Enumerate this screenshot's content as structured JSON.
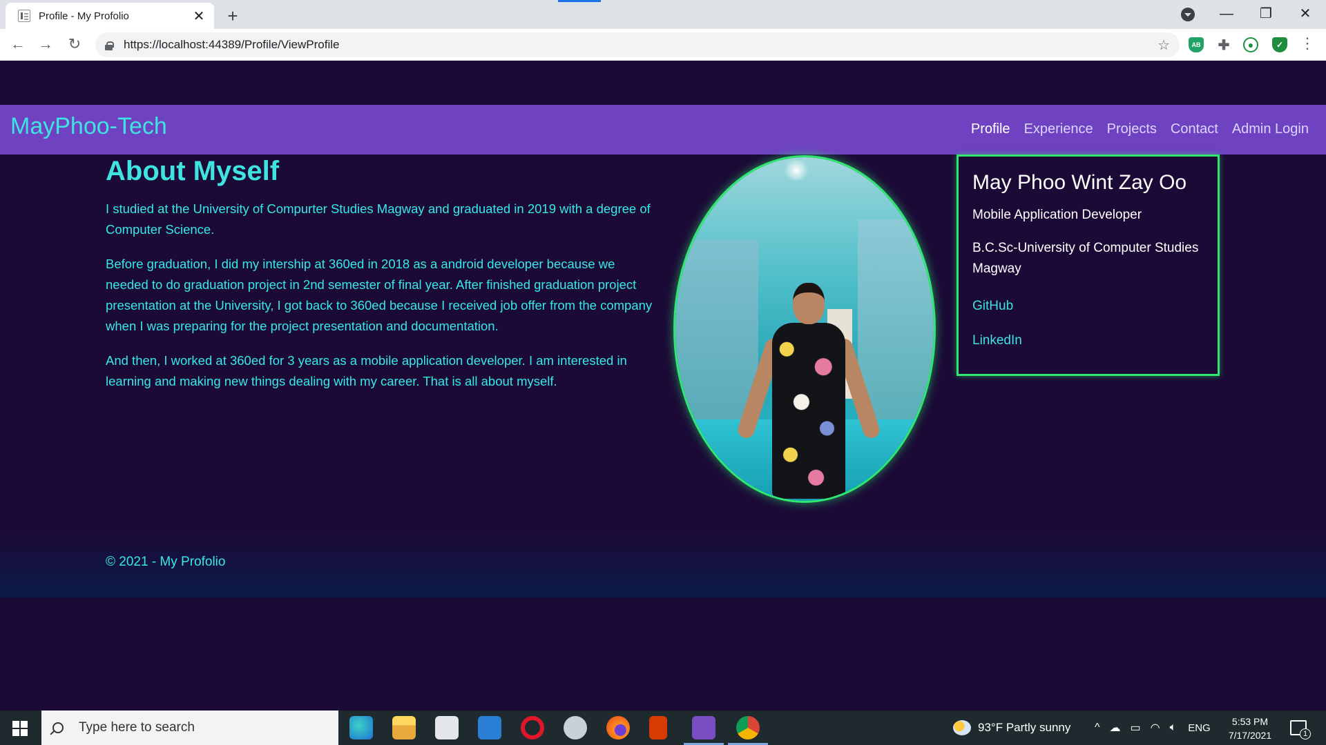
{
  "browser": {
    "tab_title": "Profile - My Profolio",
    "tab_close": "✕",
    "new_tab": "+",
    "url": "https://localhost:44389/Profile/ViewProfile",
    "minimize": "—",
    "maximize": "❐",
    "close": "✕",
    "back": "←",
    "forward": "→",
    "reload": "↻",
    "star": "☆",
    "menu": "⋮"
  },
  "extensions": {
    "adblock_label": "AB",
    "puzzle_icon": "puzzle-icon",
    "profile_icon": "profile-icon",
    "shield_label": "✓"
  },
  "site": {
    "brand": "MayPhoo-Tech",
    "nav": [
      {
        "label": "Profile",
        "active": true
      },
      {
        "label": "Experience",
        "active": false
      },
      {
        "label": "Projects",
        "active": false
      },
      {
        "label": "Contact",
        "active": false
      },
      {
        "label": "Admin Login",
        "active": false
      }
    ],
    "accent_color": "#3fe3e0",
    "navbar_color": "#6f42c1",
    "border_color": "#2ee86f"
  },
  "about": {
    "title": "About Myself",
    "paragraphs": [
      "I studied at the University of Compurter Studies Magway and graduated in 2019 with a degree of Computer Science.",
      "Before graduation, I did my intership at 360ed in 2018 as a android developer because we needed to do graduation project in 2nd semester of final year. After finished graduation project presentation at the University, I got back to 360ed because I received job offer from the company when I was preparing for the project presentation and documentation.",
      "And then, I worked at 360ed for 3 years as a mobile application developer. I am interested in learning and making new things dealing with my career. That is all about myself."
    ]
  },
  "profile_card": {
    "name": "May Phoo Wint Zay Oo",
    "role": "Mobile Application Developer",
    "education": "B.C.Sc-University of Computer Studies Magway",
    "links": [
      "GitHub",
      "LinkedIn"
    ]
  },
  "footer": {
    "copyright": "© 2021 - My Profolio"
  },
  "taskbar": {
    "search_placeholder": "Type here to search",
    "weather": "93°F  Partly sunny",
    "language": "ENG",
    "time": "5:53 PM",
    "date": "7/17/2021",
    "notification_count": "1",
    "apps": [
      "edge-icon",
      "file-explorer-icon",
      "store-icon",
      "mail-icon",
      "opera-icon",
      "app-icon",
      "firefox-icon",
      "office-icon",
      "visual-studio-icon",
      "chrome-icon"
    ]
  }
}
